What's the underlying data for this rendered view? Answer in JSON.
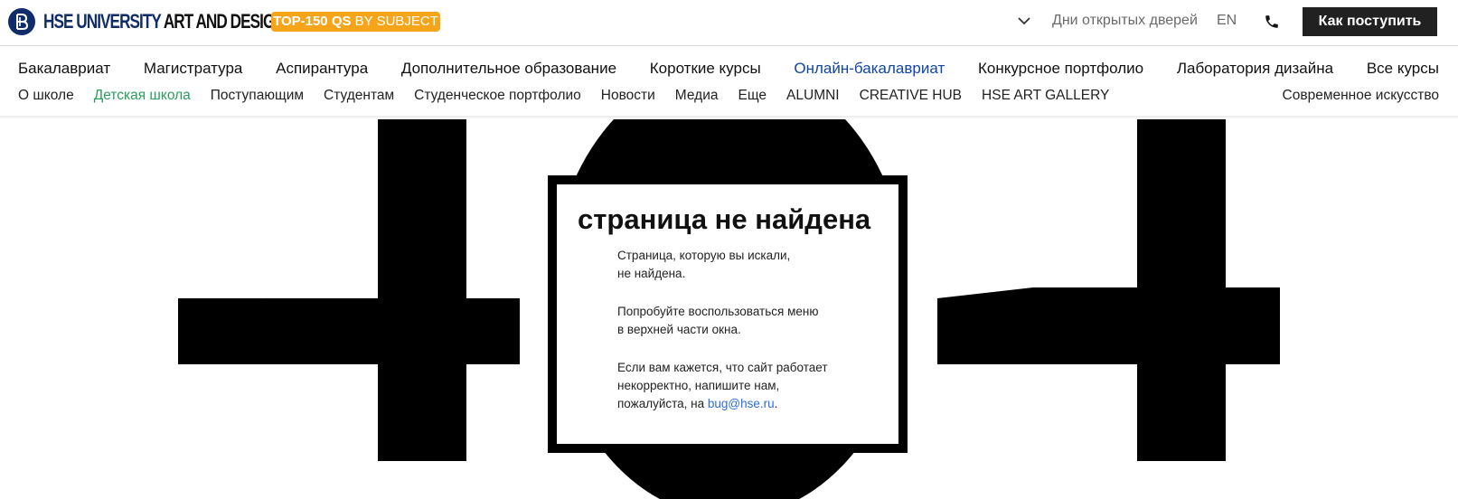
{
  "header": {
    "logo_primary": "HSE UNIVERSITY",
    "logo_secondary": "ART AND DESIGN",
    "badge_strong": "TOP-150 QS",
    "badge_rest": "BY SUBJECT",
    "open_days": "Дни открытых дверей",
    "lang": "EN",
    "apply_button": "Как поступить",
    "icons": [
      "hse-logo-icon",
      "chevron-down-icon",
      "phone-icon"
    ],
    "colors": {
      "brand": "#102d69",
      "badge": "#f6a51a",
      "apply_bg": "#212121"
    }
  },
  "nav": {
    "main": [
      "Бакалавриат",
      "Магистратура",
      "Аспирантура",
      "Дополнительное образование",
      "Короткие курсы",
      "Онлайн-бакалавриат",
      "Конкурсное портфолио",
      "Лаборатория дизайна",
      "Все курсы"
    ],
    "main_active": "Онлайн-бакалавриат",
    "sub": [
      "О школе",
      "Детская школа",
      "Поступающим",
      "Студентам",
      "Студенческое портфолио",
      "Новости",
      "Медиа",
      "Еще",
      "ALUMNI",
      "CREATIVE HUB",
      "HSE ART GALLERY"
    ],
    "sub_highlight": "Детская школа",
    "sub_right": "Современное искусство",
    "colors": {
      "active": "#1145a9",
      "highlight": "#2a9d5c"
    }
  },
  "error": {
    "code": "404",
    "title": "страница не найдена",
    "p1_line1": "Страница, которую вы искали,",
    "p1_line2": "не найдена.",
    "p2_line1": "Попробуйте воспользоваться меню",
    "p2_line2": "в верхней части окна.",
    "p3_line1": "Если вам кажется, что сайт работает",
    "p3_line2": "некорректно, напишите нам,",
    "p3_line3_prefix": "пожалуйста, на ",
    "email": "bug@hse.ru",
    "p3_suffix": "."
  }
}
